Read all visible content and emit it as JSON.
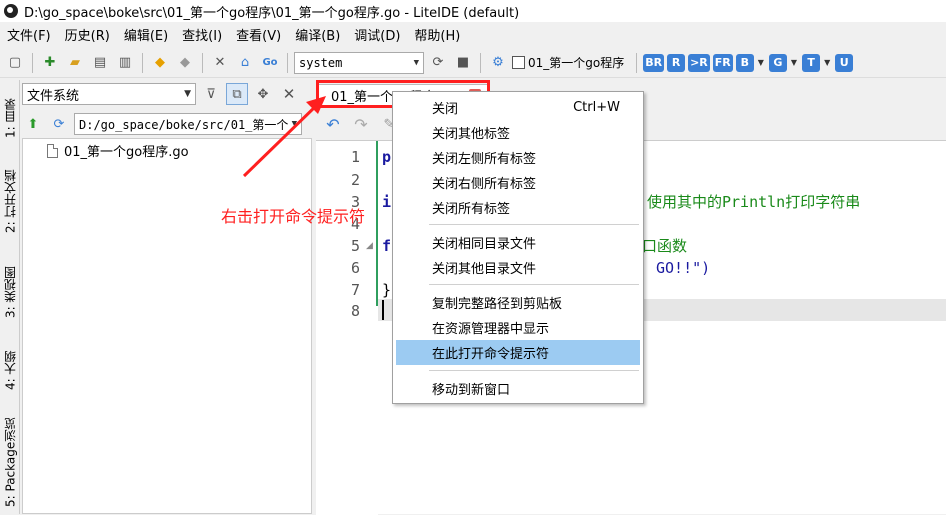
{
  "window": {
    "title": "D:\\go_space\\boke\\src\\01_第一个go程序\\01_第一个go程序.go - LiteIDE (default)"
  },
  "menu": [
    "文件(F)",
    "历史(R)",
    "编辑(E)",
    "查找(I)",
    "查看(V)",
    "编译(B)",
    "调试(D)",
    "帮助(H)"
  ],
  "toolbar": {
    "env_value": "system",
    "checkbox_label": "01_第一个go程序",
    "build_buttons": [
      "BR",
      "R",
      ">R",
      "FR",
      "B",
      "G",
      "T",
      "U"
    ]
  },
  "left_dock": [
    "1: 目录",
    "2: 打开文档",
    "3: 类视图",
    "4: 大纲",
    "5: Package浏览"
  ],
  "file_panel": {
    "view_select": "文件系统",
    "path": "D:/go_space/boke/src/01_第一个",
    "tree_item": "01_第一个go程序.go"
  },
  "editor": {
    "tab_label": "01_第一个go程序",
    "line_numbers": [
      "1",
      "2",
      "3",
      "4",
      "5",
      "6",
      "7",
      "8"
    ],
    "code_fragments": {
      "line1": "p",
      "line3": "i",
      "line3_comment": "，使用其中的Println打印字符串",
      "line5": "f",
      "line5_comment": "口函数",
      "line6": "GO!!\")",
      "line7": "}"
    }
  },
  "context_menu": {
    "items": [
      {
        "label": "关闭",
        "shortcut": "Ctrl+W"
      },
      {
        "label": "关闭其他标签"
      },
      {
        "label": "关闭左侧所有标签"
      },
      {
        "label": "关闭右侧所有标签"
      },
      {
        "label": "关闭所有标签"
      },
      {
        "label": "关闭相同目录文件"
      },
      {
        "label": "关闭其他目录文件"
      },
      {
        "label": "复制完整路径到剪贴板"
      },
      {
        "label": "在资源管理器中显示"
      },
      {
        "label": "在此打开命令提示符"
      },
      {
        "label": "移动到新窗口"
      }
    ],
    "selected": "在此打开命令提示符"
  },
  "annotation": {
    "text": "右击打开命令提示符",
    "color": "#ff2020"
  },
  "colors": {
    "highlight": "#9ccbf2",
    "accent": "#3a7fd5",
    "annotation_red": "#ff1f1f",
    "code_comment": "#1a8a1a",
    "code_string": "#1a1aa0"
  }
}
